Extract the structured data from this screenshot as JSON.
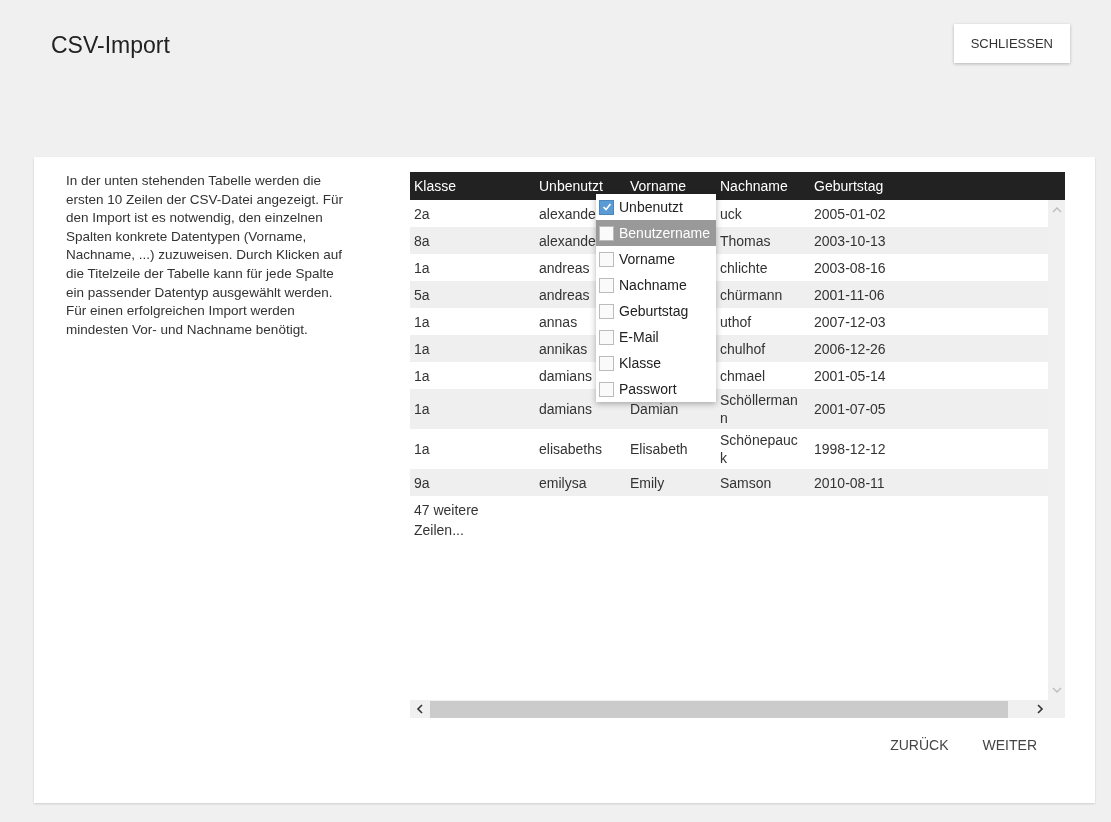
{
  "title": "CSV-Import",
  "close_button": "SCHLIESSEN",
  "description": "In der unten stehenden Tabelle werden die ersten 10 Zeilen der CSV-Datei angezeigt. Für den Import ist es notwendig, den einzelnen Spalten konkrete Datentypen (Vorname, Nachname, ...) zuzuweisen. Durch Klicken auf die Titelzeile der Tabelle kann für jede Spalte ein passender Datentyp ausgewählt werden. Für einen erfolgreichen Import werden mindesten Vor- und Nachname benötigt.",
  "table": {
    "columns": [
      "Klasse",
      "Unbenutzt",
      "Vorname",
      "Nachname",
      "Geburtstag"
    ],
    "rows": [
      [
        "2a",
        "alexande",
        "",
        "uck",
        "2005-01-02"
      ],
      [
        "8a",
        "alexande",
        "",
        "Thomas",
        "2003-10-13"
      ],
      [
        "1a",
        "andreas",
        "",
        "chlichte",
        "2003-08-16"
      ],
      [
        "5a",
        "andreas",
        "",
        "chürmann",
        "2001-11-06"
      ],
      [
        "1a",
        "annas",
        "",
        "uthof",
        "2007-12-03"
      ],
      [
        "1a",
        "annikas",
        "",
        "chulhof",
        "2006-12-26"
      ],
      [
        "1a",
        "damians",
        "",
        "chmael",
        "2001-05-14"
      ],
      [
        "1a",
        "damians",
        "Damian",
        "Schöllerman n",
        "2001-07-05"
      ],
      [
        "1a",
        "elisabeths",
        "Elisabeth",
        "Schönepauc k",
        "1998-12-12"
      ],
      [
        "9a",
        "emilysa",
        "Emily",
        "Samson",
        "2010-08-11"
      ]
    ],
    "more_rows": "47 weitere Zeilen..."
  },
  "type_menu": [
    {
      "label": "Unbenutzt",
      "checked": true,
      "selected": false
    },
    {
      "label": "Benutzername",
      "checked": false,
      "selected": true
    },
    {
      "label": "Vorname",
      "checked": false,
      "selected": false
    },
    {
      "label": "Nachname",
      "checked": false,
      "selected": false
    },
    {
      "label": "Geburtstag",
      "checked": false,
      "selected": false
    },
    {
      "label": "E-Mail",
      "checked": false,
      "selected": false
    },
    {
      "label": "Klasse",
      "checked": false,
      "selected": false
    },
    {
      "label": "Passwort",
      "checked": false,
      "selected": false
    }
  ],
  "buttons": [
    "ZURÜCK",
    "WEITER"
  ]
}
